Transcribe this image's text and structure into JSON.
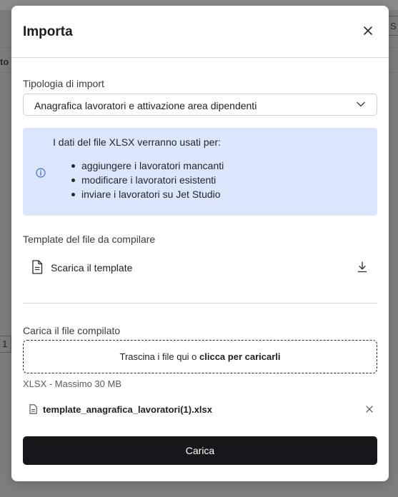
{
  "background": {
    "column_fragment": "to",
    "pill_fragment": "S",
    "row_number": "1"
  },
  "modal": {
    "title": "Importa",
    "import_type": {
      "label": "Tipologia di import",
      "selected": "Anagrafica lavoratori e attivazione area dipendenti"
    },
    "info": {
      "intro": "I dati del file XLSX verranno usati per:",
      "items": [
        "aggiungere i lavoratori mancanti",
        "modificare i lavoratori esistenti",
        "inviare i lavoratori su Jet Studio"
      ]
    },
    "template": {
      "label": "Template del file da compilare",
      "link": "Scarica il template"
    },
    "upload": {
      "label": "Carica il file compilato",
      "dropzone_prefix": "Trascina i file qui o ",
      "dropzone_link": "clicca per caricarli",
      "hint": "XLSX - Massimo 30 MB"
    },
    "file": {
      "name": "template_anagrafica_lavoratori(1).xlsx"
    },
    "submit_label": "Carica"
  },
  "colors": {
    "info_bg": "#dbe5fb",
    "info_icon": "#3b6fd8",
    "primary_button": "#17171b",
    "overlay": "#7d7d7d"
  },
  "icons": [
    "close-icon",
    "chevron-down-icon",
    "info-icon",
    "document-icon",
    "download-icon",
    "file-icon"
  ]
}
